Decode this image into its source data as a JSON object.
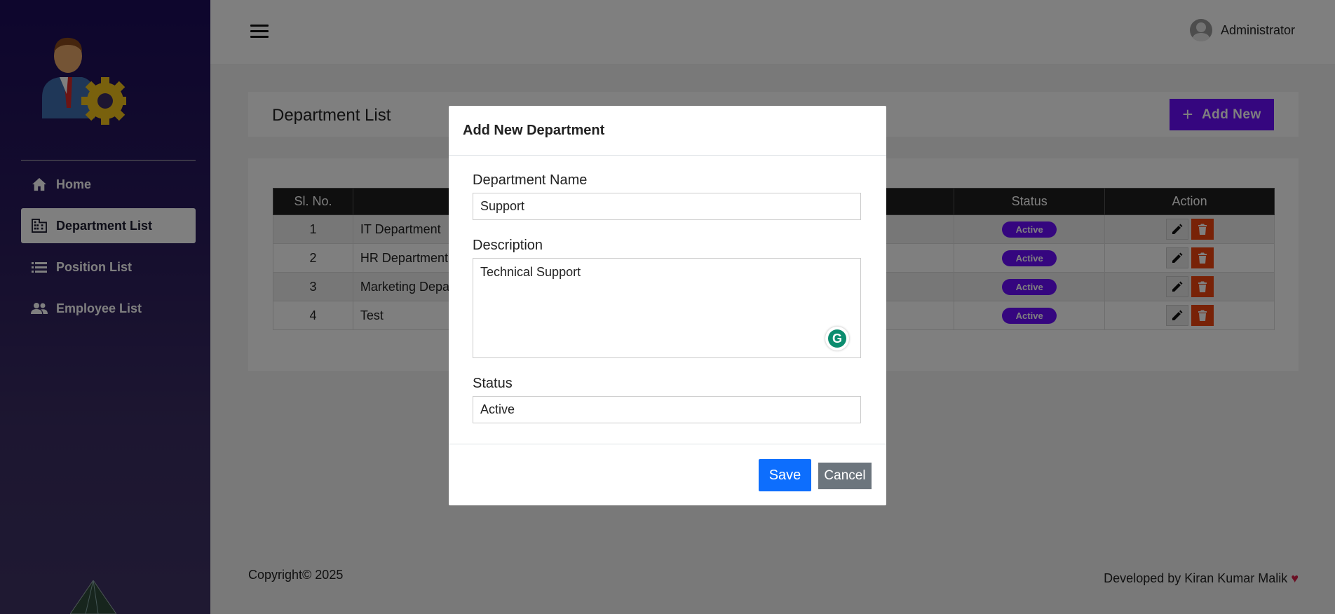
{
  "sidebar": {
    "items": [
      {
        "label": "Home",
        "icon": "home-icon"
      },
      {
        "label": "Department List",
        "icon": "building-icon"
      },
      {
        "label": "Position List",
        "icon": "list-icon"
      },
      {
        "label": "Employee List",
        "icon": "people-icon"
      }
    ],
    "active_index": 1
  },
  "header": {
    "user_name": "Administrator"
  },
  "page": {
    "title": "Department List",
    "add_label": "Add New"
  },
  "table": {
    "columns": [
      "Sl. No.",
      "",
      "Status",
      "Action"
    ],
    "rows": [
      {
        "sl": "1",
        "name": "IT Department",
        "status": "Active"
      },
      {
        "sl": "2",
        "name": "HR Department",
        "status": "Active"
      },
      {
        "sl": "3",
        "name": "Marketing Depar",
        "status": "Active"
      },
      {
        "sl": "4",
        "name": "Test",
        "status": "Active"
      }
    ]
  },
  "footer": {
    "copyright": "Copyright© 2025",
    "developer": "Developed by Kiran Kumar Malik"
  },
  "modal": {
    "title": "Add New Department",
    "name_label": "Department Name",
    "name_value": "Support",
    "desc_label": "Description",
    "desc_value": "Technical Support",
    "status_label": "Status",
    "status_value": "Active",
    "save_label": "Save",
    "cancel_label": "Cancel"
  },
  "colors": {
    "accent": "#6a0dff",
    "save": "#0d6efd",
    "cancel": "#6c757d",
    "delete": "#f0440e"
  }
}
